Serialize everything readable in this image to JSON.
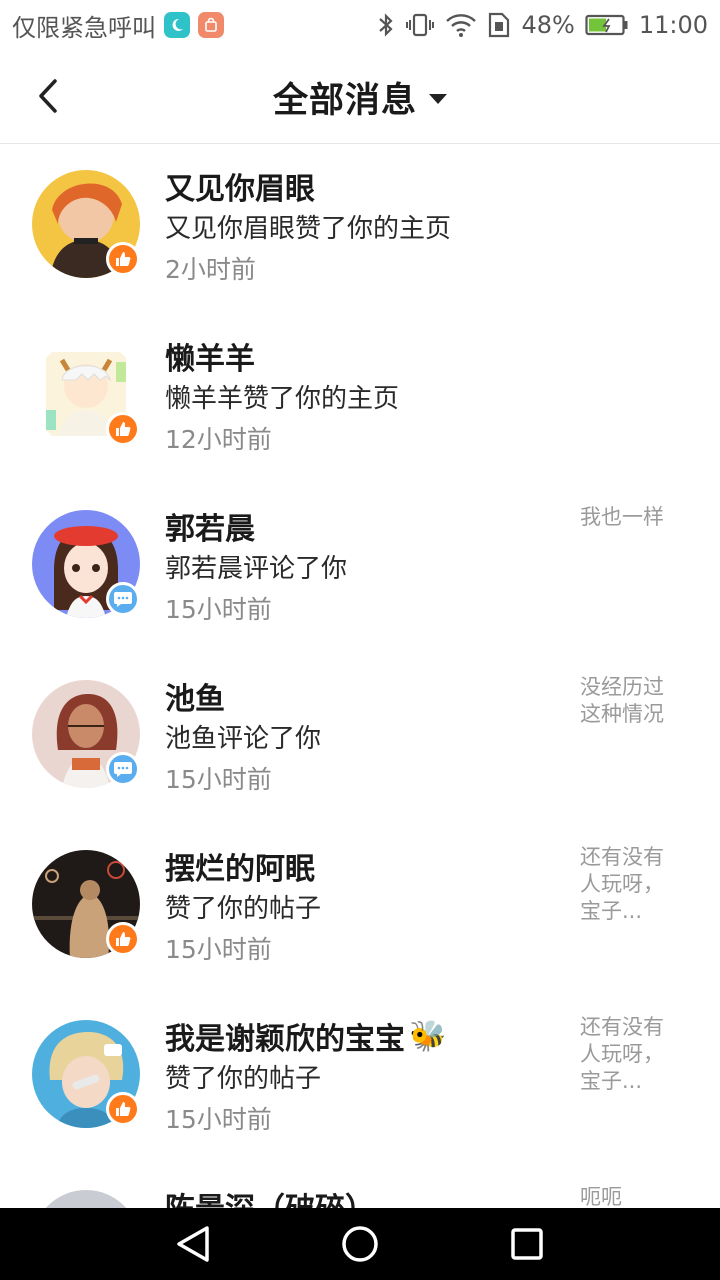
{
  "status_bar": {
    "carrier": "仅限紧急呼叫",
    "battery": "48%",
    "time": "11:00",
    "icons": [
      "moon-app-icon",
      "shopping-bag-icon",
      "bluetooth-icon",
      "vibrate-icon",
      "wifi-icon",
      "sim-icon",
      "battery-icon"
    ]
  },
  "header": {
    "title": "全部消息",
    "back_icon": "chevron-left-icon",
    "dropdown_icon": "caret-down-icon"
  },
  "messages": [
    {
      "name": "又见你眉眼",
      "desc": "又见你眉眼赞了你的主页",
      "time": "2小时前",
      "preview": "",
      "badge": "like",
      "avatar_colors": [
        "#e98b3a",
        "#f4c542"
      ]
    },
    {
      "name": "懒羊羊",
      "desc": "懒羊羊赞了你的主页",
      "time": "12小时前",
      "preview": "",
      "badge": "like",
      "avatar_colors": [
        "#f3f3f3",
        "#f7e9b0"
      ]
    },
    {
      "name": "郭若晨",
      "desc": "郭若晨评论了你",
      "time": "15小时前",
      "preview": "我也一样",
      "badge": "comment",
      "avatar_colors": [
        "#7d8cf5",
        "#e33b2f"
      ]
    },
    {
      "name": "池鱼",
      "desc": "池鱼评论了你",
      "time": "15小时前",
      "preview": "没经历过\n这种情况",
      "badge": "comment",
      "avatar_colors": [
        "#ead6d1",
        "#8a3b2c"
      ]
    },
    {
      "name": "摆烂的阿眠",
      "desc": "赞了你的帖子",
      "time": "15小时前",
      "preview": "还有没有\n人玩呀，\n宝子...",
      "badge": "like",
      "avatar_colors": [
        "#2a2420",
        "#c9a27a"
      ]
    },
    {
      "name": "我是谢颖欣的宝宝",
      "name_emoji": "🐝",
      "desc": "赞了你的帖子",
      "time": "15小时前",
      "preview": "还有没有\n人玩呀，\n宝子...",
      "badge": "like",
      "avatar_colors": [
        "#4fb0e0",
        "#e8d39a"
      ]
    },
    {
      "name": "陈景深（破碎）",
      "desc": "",
      "time": "",
      "preview": "呃呃",
      "badge": "",
      "avatar_colors": [
        "#9aa0a8",
        "#c9ccd2"
      ]
    }
  ],
  "nav_bar": {
    "back_icon": "triangle-back-icon",
    "home_icon": "circle-home-icon",
    "recents_icon": "square-recents-icon"
  }
}
